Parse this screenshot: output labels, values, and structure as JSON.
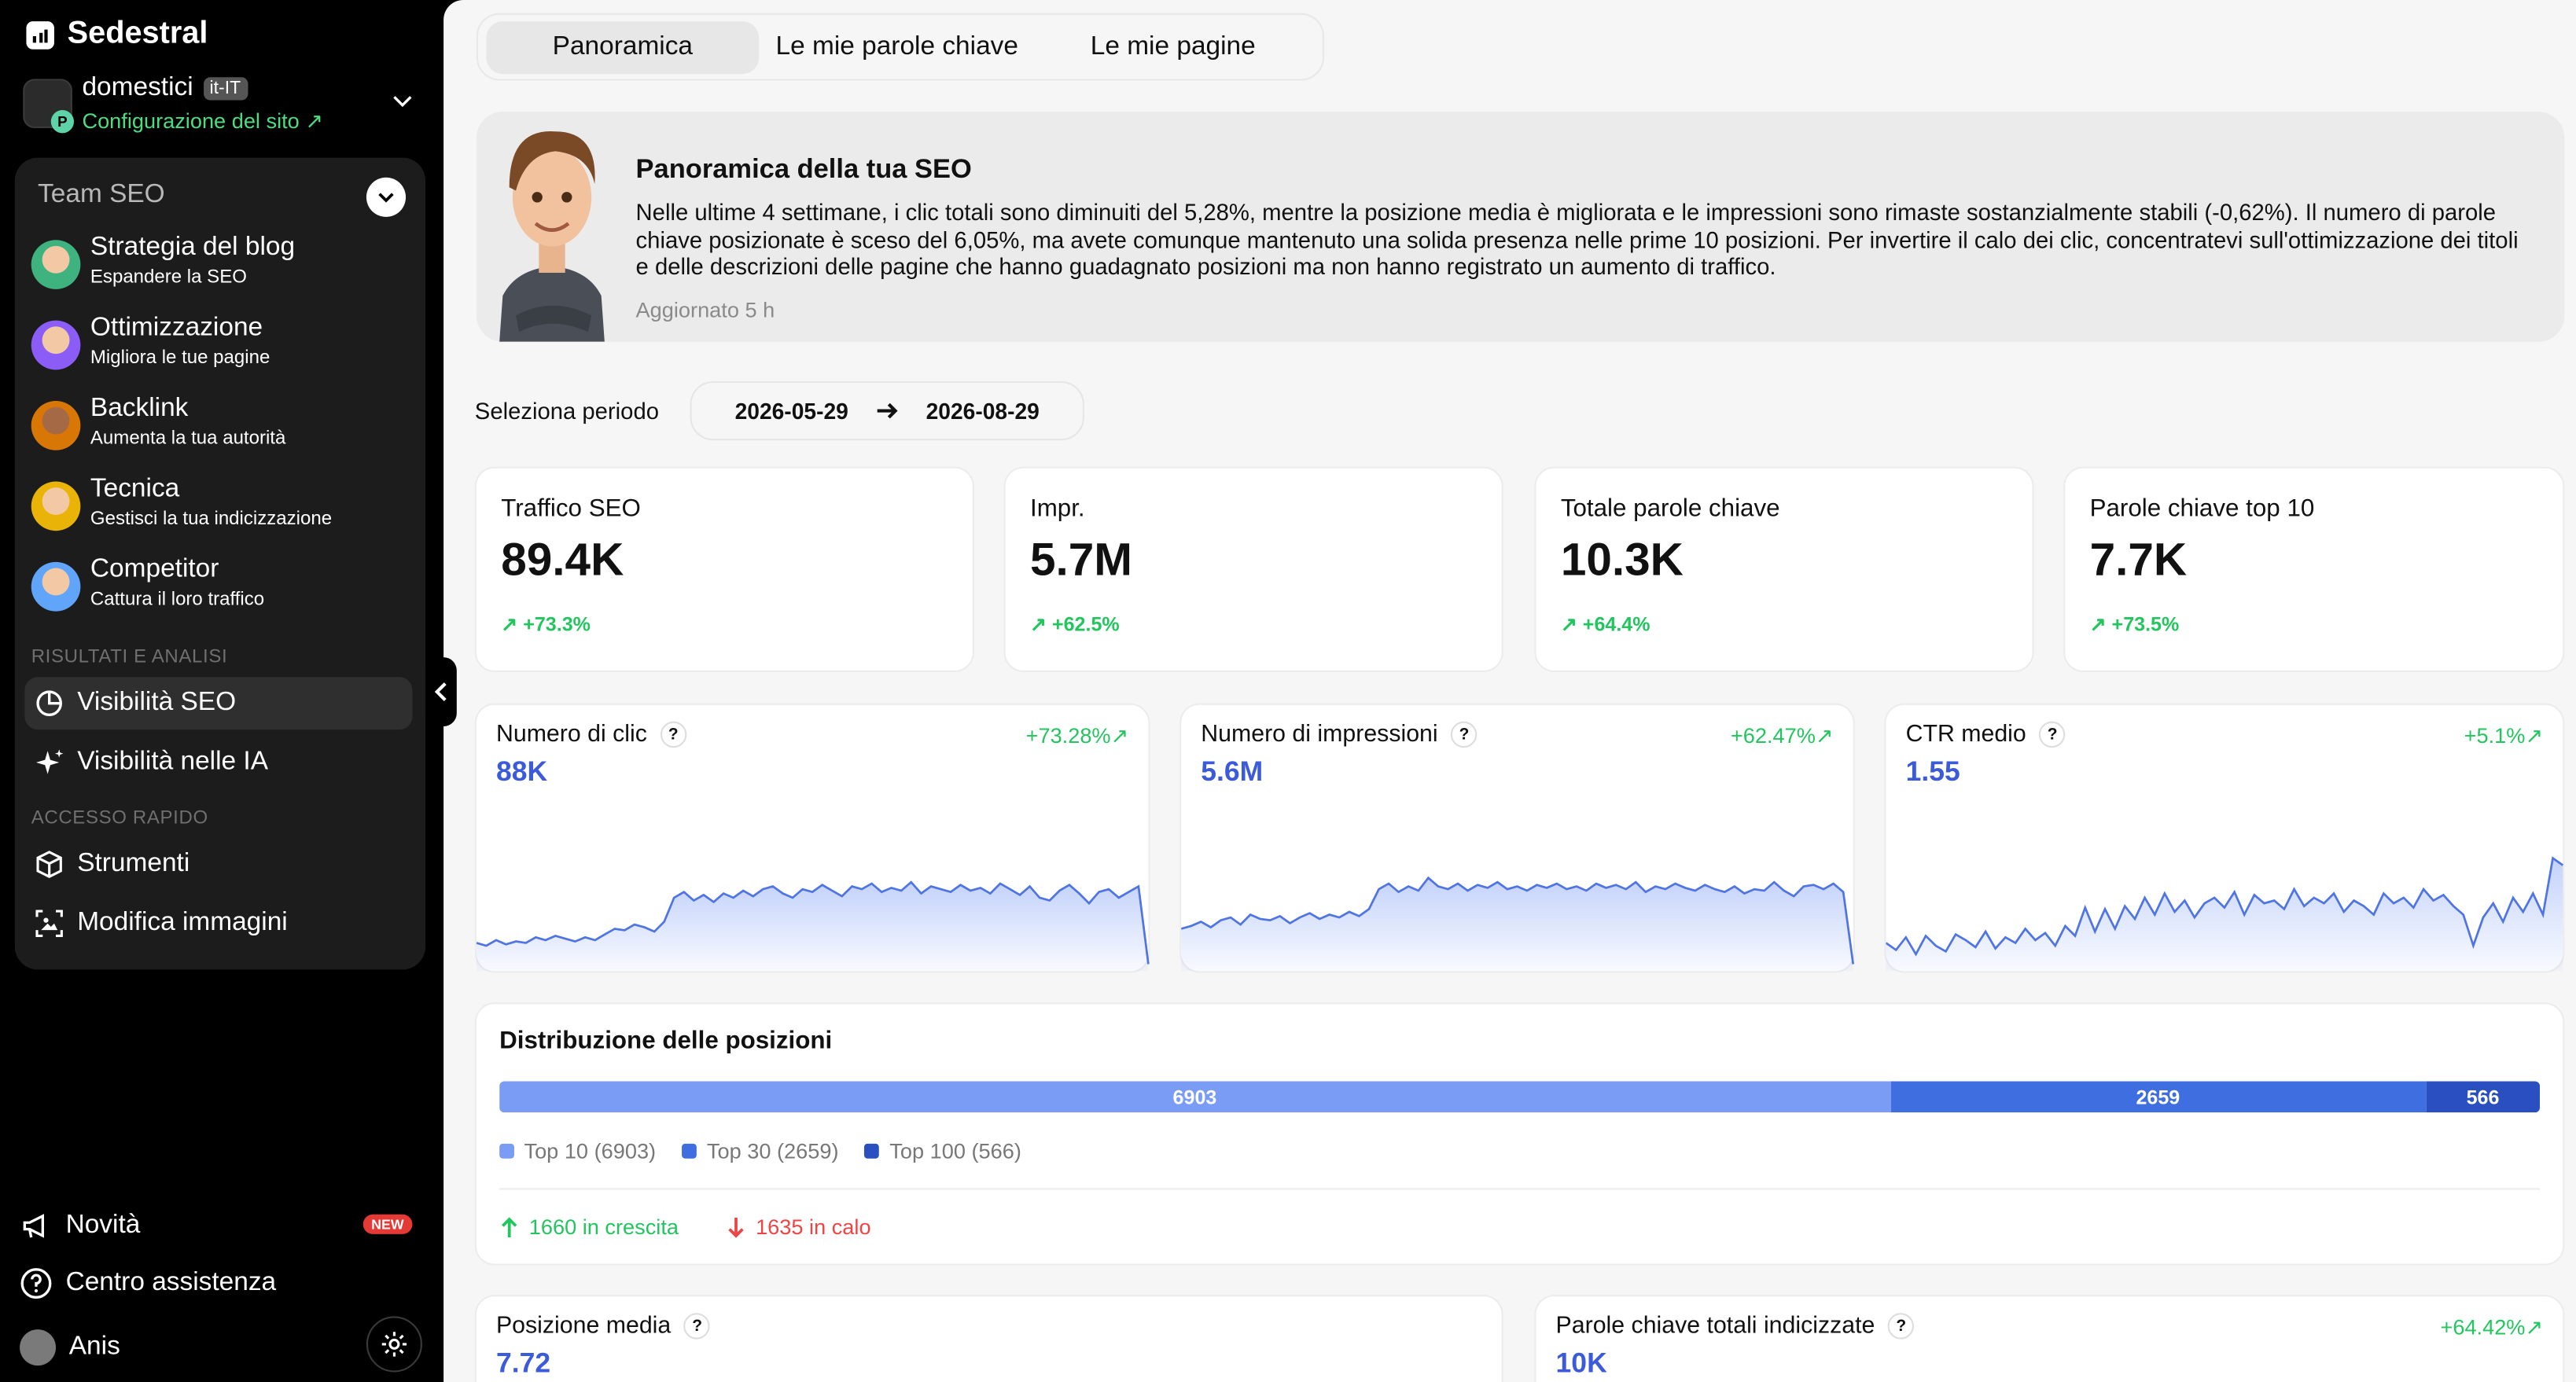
{
  "brand": {
    "name": "Sedestral"
  },
  "site": {
    "name": "domestici",
    "locale": "it-IT",
    "config_link": "Configurazione del sito ↗",
    "badge": "P"
  },
  "team": {
    "title": "Team SEO",
    "agents": [
      {
        "name": "Strategia del blog",
        "sub": "Espandere la SEO",
        "color": "#3fb37f"
      },
      {
        "name": "Ottimizzazione",
        "sub": "Migliora le tue pagine",
        "color": "#8b5cf6"
      },
      {
        "name": "Backlink",
        "sub": "Aumenta la tua autorità",
        "color": "#d97706"
      },
      {
        "name": "Tecnica",
        "sub": "Gestisci la tua indicizzazione",
        "color": "#eab308"
      },
      {
        "name": "Competitor",
        "sub": "Cattura il loro traffico",
        "color": "#60a5fa"
      }
    ],
    "results_label": "RISULTATI E ANALISI",
    "results": [
      {
        "label": "Visibilità SEO",
        "icon": "pie-chart-icon"
      },
      {
        "label": "Visibilità nelle IA",
        "icon": "sparkle-icon"
      }
    ],
    "quick_label": "ACCESSO RAPIDO",
    "quick": [
      {
        "label": "Strumenti",
        "icon": "box-icon"
      },
      {
        "label": "Modifica immagini",
        "icon": "image-edit-icon"
      }
    ]
  },
  "footer": {
    "news": "Novità",
    "news_badge": "NEW",
    "help": "Centro assistenza",
    "user": "Anis"
  },
  "tabs": [
    "Panoramica",
    "Le mie parole chiave",
    "Le mie pagine"
  ],
  "summary": {
    "title": "Panoramica della tua SEO",
    "text": "Nelle ultime 4 settimane, i clic totali sono diminuiti del 5,28%, mentre la posizione media è migliorata e le impressioni sono rimaste sostanzialmente stabili (-0,62%). Il numero di parole chiave posizionate è sceso del 6,05%, ma avete comunque mantenuto una solida presenza nelle prime 10 posizioni. Per invertire il calo dei clic, concentratevi sull'ottimizzazione dei titoli e delle descrizioni delle pagine che hanno guadagnato posizioni ma non hanno registrato un aumento di traffico.",
    "updated": "Aggiornato 5 h"
  },
  "period": {
    "label": "Seleziona periodo",
    "start": "2026-05-29",
    "end": "2026-08-29"
  },
  "kpis": [
    {
      "label": "Traffico SEO",
      "value": "89.4K",
      "delta": "↗ +73.3%"
    },
    {
      "label": "Impr.",
      "value": "5.7M",
      "delta": "↗ +62.5%"
    },
    {
      "label": "Totale parole chiave",
      "value": "10.3K",
      "delta": "↗ +64.4%"
    },
    {
      "label": "Parole chiave top 10",
      "value": "7.7K",
      "delta": "↗ +73.5%"
    }
  ],
  "metrics": [
    {
      "label": "Numero di clic",
      "value": "88K",
      "delta": "+73.28%↗"
    },
    {
      "label": "Numero di impressioni",
      "value": "5.6M",
      "delta": "+62.47%↗"
    },
    {
      "label": "CTR medio",
      "value": "1.55",
      "delta": "+5.1%↗"
    }
  ],
  "distribution": {
    "title": "Distribuzione delle posizioni",
    "segments": [
      {
        "value": 6903,
        "label": "6903",
        "color": "#7b9cf4"
      },
      {
        "value": 2659,
        "label": "2659",
        "color": "#3f6ee0"
      },
      {
        "value": 566,
        "label": "566",
        "color": "#2a4fc1"
      }
    ],
    "legend": [
      "Top 10 (6903)",
      "Top 30 (2659)",
      "Top 100 (566)"
    ],
    "up": "1660 in crescita",
    "down": "1635 in calo"
  },
  "bottom_cards": [
    {
      "label": "Posizione media",
      "value": "7.72",
      "delta": ""
    },
    {
      "label": "Parole chiave totali indicizzate",
      "value": "10K",
      "delta": "+64.42%↗"
    }
  ],
  "chart_data": [
    {
      "type": "area",
      "title": "Numero di clic",
      "y": [
        20,
        18,
        22,
        19,
        21,
        20,
        24,
        22,
        25,
        23,
        21,
        24,
        22,
        26,
        30,
        29,
        33,
        31,
        28,
        35,
        52,
        56,
        50,
        54,
        49,
        55,
        52,
        57,
        53,
        58,
        60,
        55,
        52,
        58,
        56,
        61,
        57,
        53,
        60,
        58,
        62,
        56,
        59,
        57,
        63,
        55,
        60,
        58,
        56,
        61,
        57,
        59,
        55,
        62,
        58,
        54,
        60,
        52,
        50,
        57,
        61,
        55,
        48,
        56,
        58,
        52,
        56,
        60,
        5
      ]
    },
    {
      "type": "area",
      "title": "Numero di impressioni",
      "y": [
        30,
        32,
        35,
        31,
        36,
        38,
        33,
        40,
        37,
        36,
        39,
        34,
        38,
        41,
        37,
        40,
        38,
        42,
        39,
        44,
        58,
        62,
        56,
        60,
        57,
        66,
        60,
        58,
        62,
        57,
        61,
        59,
        63,
        58,
        60,
        57,
        61,
        59,
        62,
        58,
        60,
        57,
        62,
        59,
        61,
        58,
        63,
        56,
        60,
        58,
        62,
        59,
        57,
        61,
        58,
        56,
        60,
        55,
        58,
        57,
        63,
        57,
        53,
        60,
        61,
        58,
        62,
        56,
        5
      ]
    },
    {
      "type": "area",
      "title": "CTR medio",
      "y": [
        20,
        15,
        24,
        12,
        25,
        18,
        14,
        26,
        22,
        17,
        28,
        16,
        24,
        20,
        30,
        22,
        27,
        18,
        32,
        25,
        45,
        28,
        44,
        30,
        46,
        37,
        52,
        40,
        55,
        42,
        50,
        38,
        48,
        52,
        45,
        56,
        40,
        54,
        48,
        50,
        44,
        58,
        46,
        52,
        48,
        55,
        42,
        50,
        46,
        40,
        55,
        48,
        52,
        45,
        58,
        50,
        54,
        46,
        40,
        18,
        38,
        48,
        35,
        52,
        42,
        55,
        40,
        80,
        75
      ]
    }
  ]
}
